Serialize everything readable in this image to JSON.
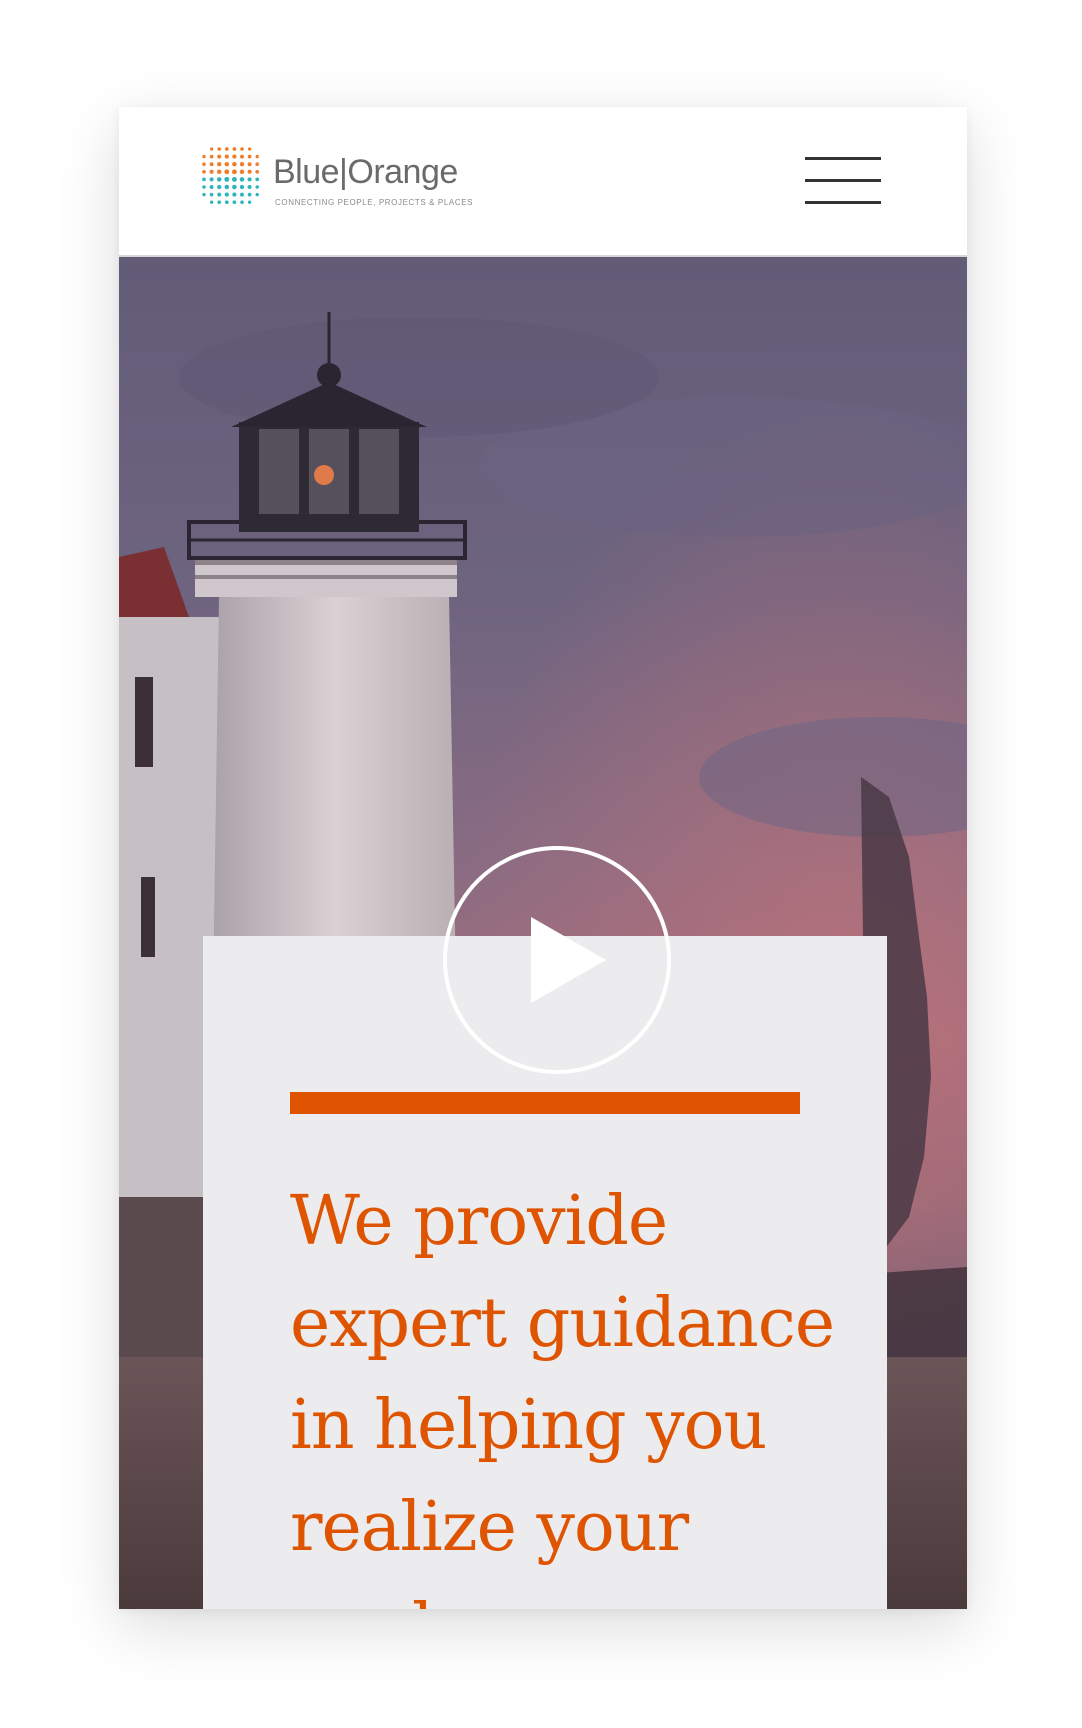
{
  "header": {
    "logo": {
      "wordmark": "Blue|Orange",
      "tagline": "CONNECTING PEOPLE, PROJECTS & PLACES",
      "icon": "dot-grid-logo-icon"
    },
    "menu_icon": "hamburger-menu-icon"
  },
  "hero": {
    "background": "lighthouse-at-dusk-photo",
    "play_icon": "play-icon",
    "headline": "We provide expert guidance in helping you realize your goals."
  },
  "colors": {
    "accent_orange": "#de5400",
    "card_background": "#ececee",
    "sky_purple": "#6c6481",
    "logo_teal": "#2fb4bf",
    "logo_orange": "#ef7d2b"
  }
}
